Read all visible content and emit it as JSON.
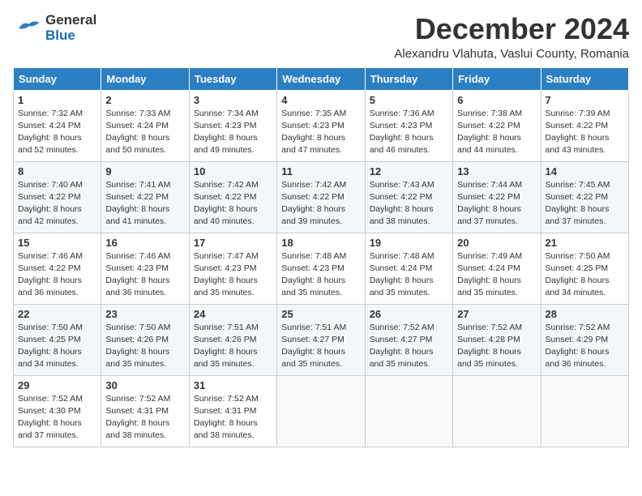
{
  "logo": {
    "general": "General",
    "blue": "Blue"
  },
  "title": "December 2024",
  "subtitle": "Alexandru Vlahuta, Vaslui County, Romania",
  "days_of_week": [
    "Sunday",
    "Monday",
    "Tuesday",
    "Wednesday",
    "Thursday",
    "Friday",
    "Saturday"
  ],
  "weeks": [
    [
      {
        "day": 1,
        "sunrise": "7:32 AM",
        "sunset": "4:24 PM",
        "daylight": "8 hours and 52 minutes."
      },
      {
        "day": 2,
        "sunrise": "7:33 AM",
        "sunset": "4:24 PM",
        "daylight": "8 hours and 50 minutes."
      },
      {
        "day": 3,
        "sunrise": "7:34 AM",
        "sunset": "4:23 PM",
        "daylight": "8 hours and 49 minutes."
      },
      {
        "day": 4,
        "sunrise": "7:35 AM",
        "sunset": "4:23 PM",
        "daylight": "8 hours and 47 minutes."
      },
      {
        "day": 5,
        "sunrise": "7:36 AM",
        "sunset": "4:23 PM",
        "daylight": "8 hours and 46 minutes."
      },
      {
        "day": 6,
        "sunrise": "7:38 AM",
        "sunset": "4:22 PM",
        "daylight": "8 hours and 44 minutes."
      },
      {
        "day": 7,
        "sunrise": "7:39 AM",
        "sunset": "4:22 PM",
        "daylight": "8 hours and 43 minutes."
      }
    ],
    [
      {
        "day": 8,
        "sunrise": "7:40 AM",
        "sunset": "4:22 PM",
        "daylight": "8 hours and 42 minutes."
      },
      {
        "day": 9,
        "sunrise": "7:41 AM",
        "sunset": "4:22 PM",
        "daylight": "8 hours and 41 minutes."
      },
      {
        "day": 10,
        "sunrise": "7:42 AM",
        "sunset": "4:22 PM",
        "daylight": "8 hours and 40 minutes."
      },
      {
        "day": 11,
        "sunrise": "7:42 AM",
        "sunset": "4:22 PM",
        "daylight": "8 hours and 39 minutes."
      },
      {
        "day": 12,
        "sunrise": "7:43 AM",
        "sunset": "4:22 PM",
        "daylight": "8 hours and 38 minutes."
      },
      {
        "day": 13,
        "sunrise": "7:44 AM",
        "sunset": "4:22 PM",
        "daylight": "8 hours and 37 minutes."
      },
      {
        "day": 14,
        "sunrise": "7:45 AM",
        "sunset": "4:22 PM",
        "daylight": "8 hours and 37 minutes."
      }
    ],
    [
      {
        "day": 15,
        "sunrise": "7:46 AM",
        "sunset": "4:22 PM",
        "daylight": "8 hours and 36 minutes."
      },
      {
        "day": 16,
        "sunrise": "7:46 AM",
        "sunset": "4:23 PM",
        "daylight": "8 hours and 36 minutes."
      },
      {
        "day": 17,
        "sunrise": "7:47 AM",
        "sunset": "4:23 PM",
        "daylight": "8 hours and 35 minutes."
      },
      {
        "day": 18,
        "sunrise": "7:48 AM",
        "sunset": "4:23 PM",
        "daylight": "8 hours and 35 minutes."
      },
      {
        "day": 19,
        "sunrise": "7:48 AM",
        "sunset": "4:24 PM",
        "daylight": "8 hours and 35 minutes."
      },
      {
        "day": 20,
        "sunrise": "7:49 AM",
        "sunset": "4:24 PM",
        "daylight": "8 hours and 35 minutes."
      },
      {
        "day": 21,
        "sunrise": "7:50 AM",
        "sunset": "4:25 PM",
        "daylight": "8 hours and 34 minutes."
      }
    ],
    [
      {
        "day": 22,
        "sunrise": "7:50 AM",
        "sunset": "4:25 PM",
        "daylight": "8 hours and 34 minutes."
      },
      {
        "day": 23,
        "sunrise": "7:50 AM",
        "sunset": "4:26 PM",
        "daylight": "8 hours and 35 minutes."
      },
      {
        "day": 24,
        "sunrise": "7:51 AM",
        "sunset": "4:26 PM",
        "daylight": "8 hours and 35 minutes."
      },
      {
        "day": 25,
        "sunrise": "7:51 AM",
        "sunset": "4:27 PM",
        "daylight": "8 hours and 35 minutes."
      },
      {
        "day": 26,
        "sunrise": "7:52 AM",
        "sunset": "4:27 PM",
        "daylight": "8 hours and 35 minutes."
      },
      {
        "day": 27,
        "sunrise": "7:52 AM",
        "sunset": "4:28 PM",
        "daylight": "8 hours and 35 minutes."
      },
      {
        "day": 28,
        "sunrise": "7:52 AM",
        "sunset": "4:29 PM",
        "daylight": "8 hours and 36 minutes."
      }
    ],
    [
      {
        "day": 29,
        "sunrise": "7:52 AM",
        "sunset": "4:30 PM",
        "daylight": "8 hours and 37 minutes."
      },
      {
        "day": 30,
        "sunrise": "7:52 AM",
        "sunset": "4:31 PM",
        "daylight": "8 hours and 38 minutes."
      },
      {
        "day": 31,
        "sunrise": "7:52 AM",
        "sunset": "4:31 PM",
        "daylight": "8 hours and 38 minutes."
      },
      null,
      null,
      null,
      null
    ]
  ],
  "labels": {
    "sunrise": "Sunrise:",
    "sunset": "Sunset:",
    "daylight": "Daylight:"
  }
}
